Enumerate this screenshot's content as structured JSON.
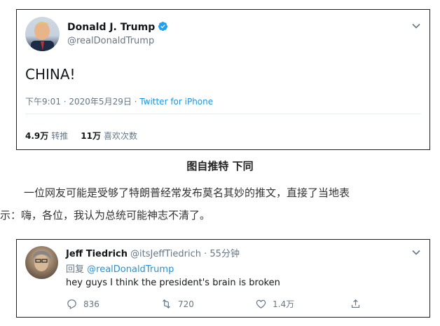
{
  "tweet1": {
    "display_name": "Donald J. Trump",
    "handle": "@realDonaldTrump",
    "text": "CHINA!",
    "time": "下午9:01 · 2020年5月29日 · ",
    "source": "Twitter for iPhone",
    "retweets_count": "4.9万",
    "retweets_label": "转推",
    "likes_count": "11万",
    "likes_label": "喜欢次数"
  },
  "article": {
    "caption": "图自推特  下同",
    "paragraph_line1": "一位网友可能是受够了特朗普经常发布莫名其妙的推文，直接了当地表",
    "paragraph_line2": "示：嗨，各位，我认为总统可能神志不清了。"
  },
  "tweet2": {
    "display_name": "Jeff Tiedrich",
    "handle_time": "@itsJeffTiedrich · 55分钟",
    "reply_prefix": "回复 ",
    "reply_to": "@realDonaldTrump",
    "text": "hey guys I think the president's brain is broken",
    "replies": "836",
    "retweets": "720",
    "likes": "1.4万"
  },
  "colors": {
    "link": "#1b95e0",
    "muted": "#657786",
    "text": "#14171a"
  }
}
